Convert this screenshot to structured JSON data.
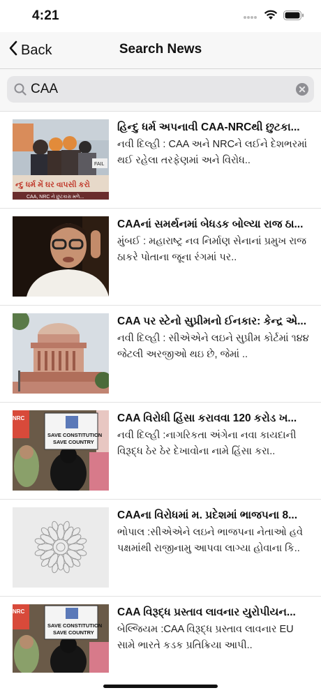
{
  "status": {
    "time": "4:21"
  },
  "nav": {
    "back_label": "Back",
    "title": "Search News"
  },
  "search": {
    "value": "CAA"
  },
  "news": [
    {
      "title": "હિન્દુ ધર્મ અપનાવી CAA-NRCથી છુટકા...",
      "summary": "નવી દિલ્હી : CAA અને NRCને લઈને દેશભરમાં થઈ રહેલા તરફેણમાં અને વિરોધ.."
    },
    {
      "title": "CAAનાં સમર્થનમાં બેધડક બોલ્યા રાજ ઠા...",
      "summary": "મુંબઈ : મહારાષ્ટ્ર નવ નિર્માણ સેનાનાં પ્રમુખ રાજ ઠાકરે પોતાના જૂના રંગમાં પર.."
    },
    {
      "title": "CAA પર સ્ટેનો સુપ્રીમનો ઈનકાર: કેન્દ્ર એ...",
      "summary": "નવી દિલ્હી : સીએએને લઇને સુપ્રીમ કોર્ટમાં ૧૪૪ જેટલી અરજીઓ થઇ છે, જેમાં .."
    },
    {
      "title": "CAA વિરોધી હિંસા કરાવવા 120 કરોડ ખ...",
      "summary": "નવી દિલ્હી :નાગરિકતા અંગેના નવા કાયદાની વિરૂદ્ધ ઠેર ઠેર દેખાવોના નામે હિંસા કરા.."
    },
    {
      "title": "CAAના વિરોધમાં મ. પ્રદેશમાં ભાજપના 8...",
      "summary": "ભોપાલ :સીએએને લઇને ભાજપના નેતાઓ હવે પક્ષમાંથી રાજીનામુ આપવા લાગ્યા હોવાના કિ.."
    },
    {
      "title": "CAA વિરૂદ્ધ પ્રસ્તાવ લાવનાર યુરોપીયન...",
      "summary": "બેલ્જિયમ :CAA વિરૂદ્ધ પ્રસ્તાવ લાવનાર EU સામે ભારતે કડક પ્રતિક્રિયા આપી.."
    }
  ],
  "thumb_text": {
    "t1_banner": "ન્દુ ધર્મ મેં ઘર વાપસી કરો",
    "t1_caption": "CAA, NRC ને છુટકારા મળે...",
    "t1_fail": "FAIL",
    "t4_sign_l1": "SAVE CONSTITUTION",
    "t4_sign_l2": "SAVE COUNTRY",
    "t4_nrc": "NRC",
    "t6_sign_l1": "SAVE CONSTITUTION",
    "t6_sign_l2": "SAVE COUNTRY",
    "t6_nrc": "NRC"
  }
}
